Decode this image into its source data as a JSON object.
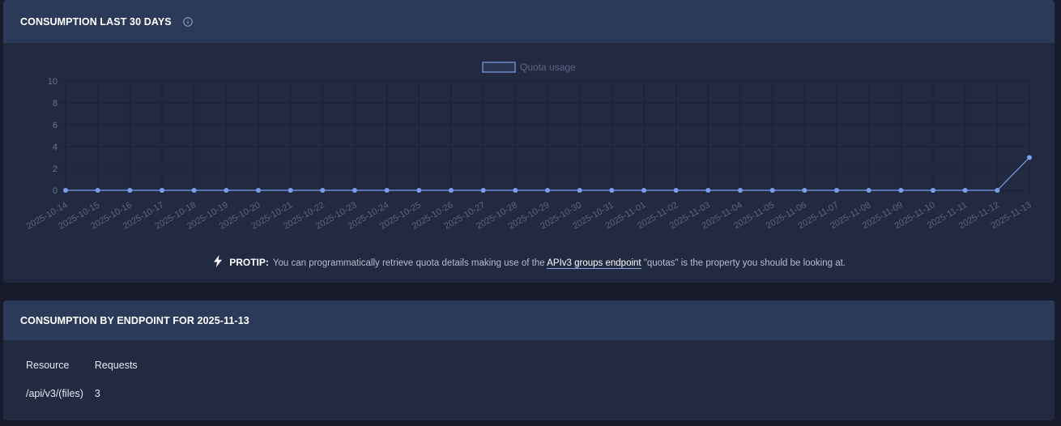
{
  "consumption": {
    "title": "CONSUMPTION LAST 30 DAYS",
    "protip": {
      "label": "PROTIP:",
      "text_before": "You can programmatically retrieve quota details making use of the",
      "link_text": "APIv3 groups endpoint",
      "text_after": "\"quotas\" is the property you should be looking at."
    }
  },
  "chart_data": {
    "type": "line",
    "title": "",
    "xlabel": "",
    "ylabel": "",
    "ylim": [
      0,
      10
    ],
    "y_ticks": [
      0,
      2,
      4,
      6,
      8,
      10
    ],
    "grid": true,
    "legend": "top-center",
    "x": [
      "2025-10-14",
      "2025-10-15",
      "2025-10-16",
      "2025-10-17",
      "2025-10-18",
      "2025-10-19",
      "2025-10-20",
      "2025-10-21",
      "2025-10-22",
      "2025-10-23",
      "2025-10-24",
      "2025-10-25",
      "2025-10-26",
      "2025-10-27",
      "2025-10-28",
      "2025-10-29",
      "2025-10-30",
      "2025-10-31",
      "2025-11-01",
      "2025-11-02",
      "2025-11-03",
      "2025-11-04",
      "2025-11-05",
      "2025-11-06",
      "2025-11-07",
      "2025-11-08",
      "2025-11-09",
      "2025-11-10",
      "2025-11-11",
      "2025-11-12",
      "2025-11-13"
    ],
    "series": [
      {
        "name": "Quota usage",
        "color": "#7b9ee8",
        "values": [
          0,
          0,
          0,
          0,
          0,
          0,
          0,
          0,
          0,
          0,
          0,
          0,
          0,
          0,
          0,
          0,
          0,
          0,
          0,
          0,
          0,
          0,
          0,
          0,
          0,
          0,
          0,
          0,
          0,
          0,
          3
        ]
      }
    ]
  },
  "endpoint": {
    "title": "CONSUMPTION BY ENDPOINT FOR 2025-11-13",
    "columns": [
      "Resource",
      "Requests"
    ],
    "rows": [
      {
        "resource": "/api/v3/(files)",
        "requests": "3"
      }
    ]
  },
  "colors": {
    "page_bg": "#181b2c",
    "card_bg": "#222a42",
    "header_bg": "#2c3a5a",
    "series": "#7b9ee8"
  }
}
